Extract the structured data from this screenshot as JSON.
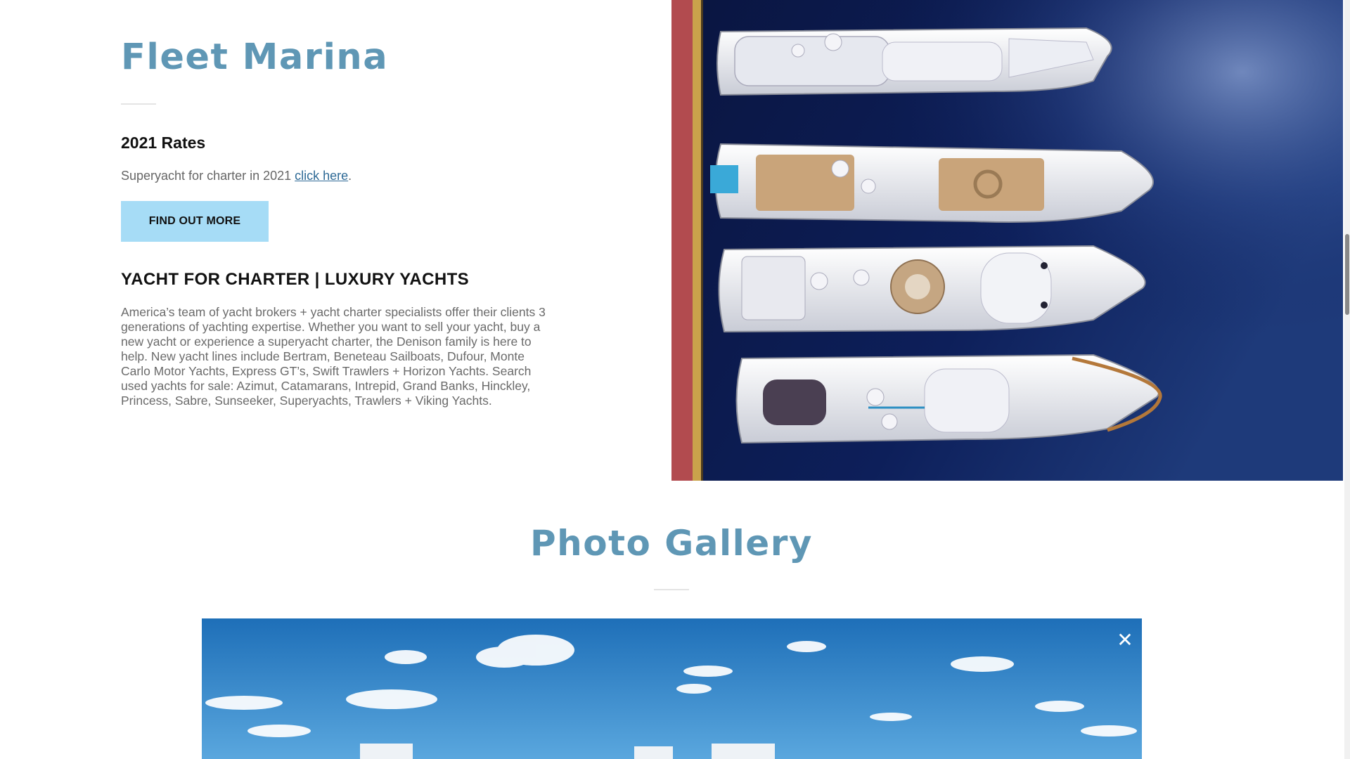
{
  "hero": {
    "title": "Fleet Marina",
    "rates": {
      "heading": "2021 Rates",
      "text": "Superyacht for charter in 2021 ",
      "link_label": "click here",
      "text_end": "."
    },
    "cta_label": "FIND OUT MORE",
    "charter": {
      "heading": "YACHT FOR CHARTER | LUXURY YACHTS",
      "body": "America’s team of yacht brokers + yacht charter specialists offer their clients 3 generations of yachting expertise. Whether you want to sell your yacht, buy a new yacht or experience a superyacht charter, the Denison family is here to help. New yacht lines include Bertram, Beneteau Sailboats, Dufour, Monte Carlo Motor Yachts, Express GT’s, Swift Trawlers + Horizon Yachts. Search used yachts for sale: Azimut, Catamarans, Intrepid, Grand Banks, Hinckley, Princess, Sabre, Sunseeker, Superyachts, Trawlers + Viking Yachts."
    }
  },
  "gallery": {
    "title": "Photo Gallery",
    "close_icon": "close-icon",
    "close_glyph": "✕"
  },
  "colors": {
    "heading_accent": "#5f97b5",
    "button_bg": "#a6dcf6",
    "link": "#2e6a96",
    "water": "#0b1a4d",
    "sky": "#2f86c8"
  }
}
